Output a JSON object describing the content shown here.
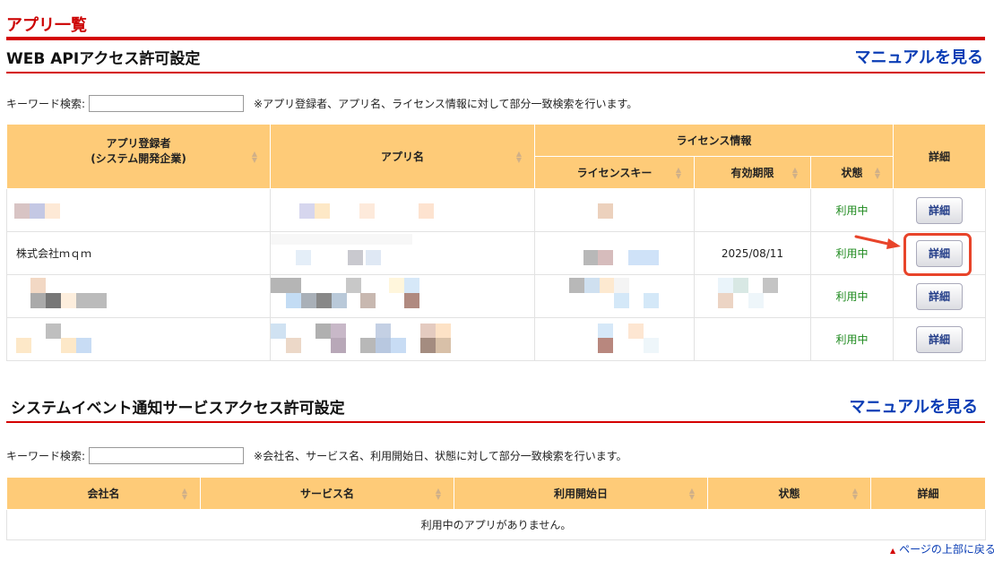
{
  "page": {
    "title": "アプリ一覧"
  },
  "webapi": {
    "heading": "WEB APIアクセス許可設定",
    "manual_link": "マニュアルを見る",
    "search_label": "キーワード検索:",
    "search_value": "",
    "search_hint": "※アプリ登録者、アプリ名、ライセンス情報に対して部分一致検索を行います。",
    "columns": {
      "registrant": "アプリ登録者",
      "registrant_sub": "(システム開発企業)",
      "app_name": "アプリ名",
      "license_group": "ライセンス情報",
      "license_key": "ライセンスキー",
      "expiry": "有効期限",
      "status": "状態",
      "detail": "詳細"
    },
    "rows": [
      {
        "registrant": "",
        "expiry": "",
        "status": "利用中",
        "detail": "詳細"
      },
      {
        "registrant": "株式会社ｍｑｍ",
        "expiry": "2025/08/11",
        "status": "利用中",
        "detail": "詳細"
      },
      {
        "registrant": "",
        "expiry": "",
        "status": "利用中",
        "detail": "詳細"
      },
      {
        "registrant": "",
        "expiry": "",
        "status": "利用中",
        "detail": "詳細"
      }
    ]
  },
  "sysevent": {
    "heading": "システムイベント通知サービスアクセス許可設定",
    "manual_link": "マニュアルを見る",
    "search_label": "キーワード検索:",
    "search_value": "",
    "search_hint": "※会社名、サービス名、利用開始日、状態に対して部分一致検索を行います。",
    "columns": {
      "company": "会社名",
      "service": "サービス名",
      "start_date": "利用開始日",
      "status": "状態",
      "detail": "詳細"
    },
    "empty_message": "利用中のアプリがありません。"
  },
  "footer": {
    "page_top": "ページの上部に戻る"
  },
  "colors": {
    "accent_red": "#d40000",
    "header_orange": "#fecb78",
    "link_blue": "#0a3db5",
    "status_green": "#1e8a1e",
    "callout": "#e8442a"
  }
}
